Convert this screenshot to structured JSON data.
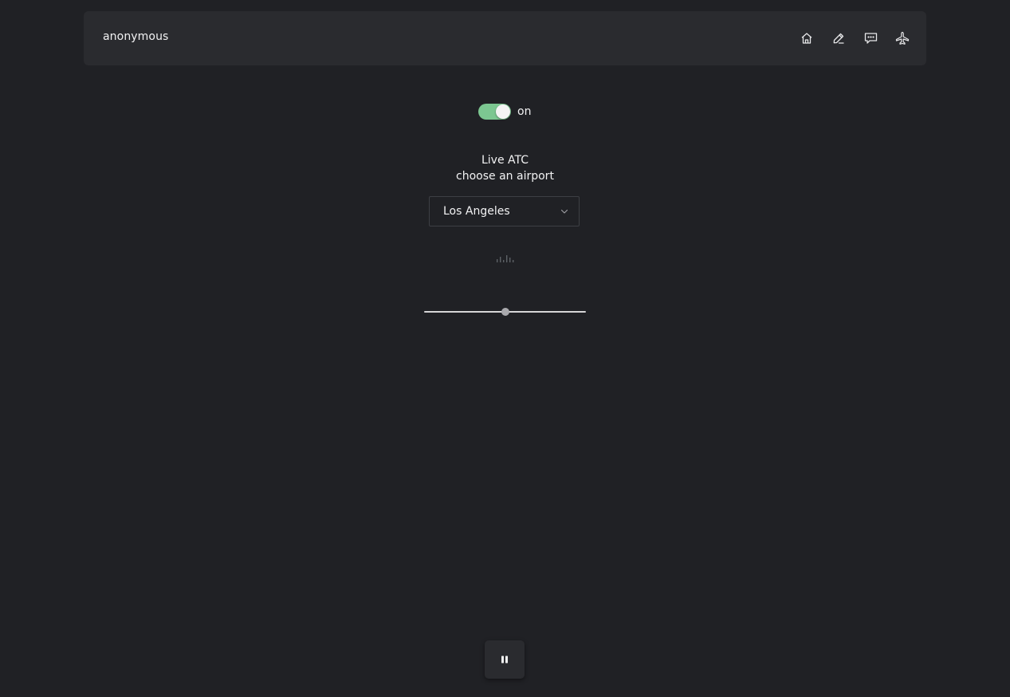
{
  "header": {
    "username": "anonymous",
    "nav": [
      {
        "name": "home-icon"
      },
      {
        "name": "pencil-icon"
      },
      {
        "name": "chat-icon"
      },
      {
        "name": "airplane-icon"
      }
    ]
  },
  "toggle": {
    "state": true,
    "label": "on",
    "active_color": "#7cc791"
  },
  "main": {
    "title": "Live ATC",
    "subtitle": "choose an airport"
  },
  "airport_select": {
    "selected": "Los Angeles"
  },
  "volume": {
    "value": 0.5
  },
  "player": {
    "control_icon": "pause-icon"
  },
  "colors": {
    "background": "#202125",
    "panel": "#2a2b2f",
    "text": "#f2f2f3"
  }
}
